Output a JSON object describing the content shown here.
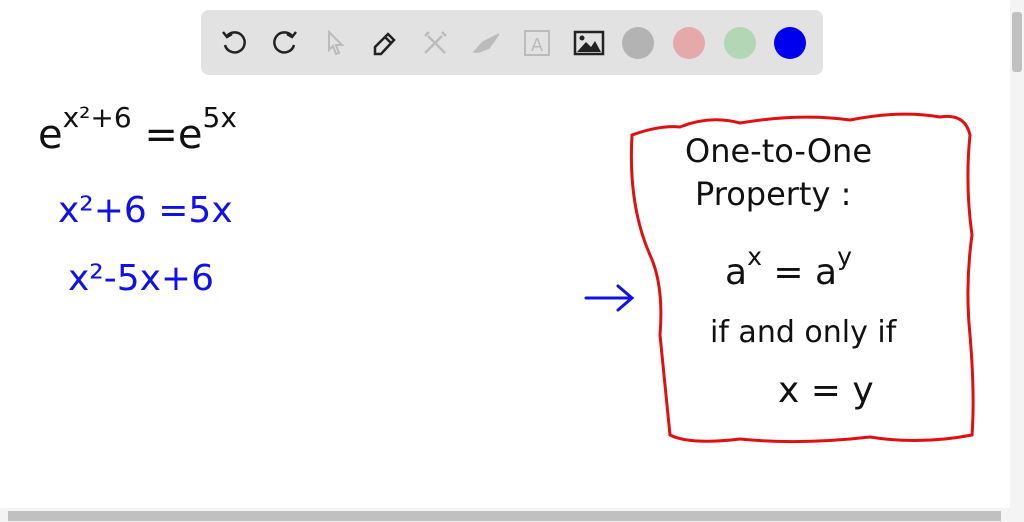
{
  "toolbar": {
    "tools": [
      "undo-icon",
      "redo-icon",
      "select-icon",
      "pen-icon",
      "tools-icon",
      "eraser-icon",
      "text-icon",
      "image-icon"
    ],
    "colors": [
      "#b3b3b3",
      "#e5a9ab",
      "#b3d6b5",
      "#0000ee"
    ]
  },
  "board": {
    "line1": {
      "base1": "e",
      "exp1": "x²+6",
      "eq": "=e",
      "exp2": "5x"
    },
    "line2": "x²+6 =5x",
    "line3": "x²-5x+6",
    "box": {
      "title1": "One-to-One",
      "title2": "Property :",
      "eq_base1": "a",
      "eq_exp1": "x",
      "eq_mid": " = a",
      "eq_exp2": "y",
      "cond": "if and only if",
      "result": "x = y"
    }
  }
}
